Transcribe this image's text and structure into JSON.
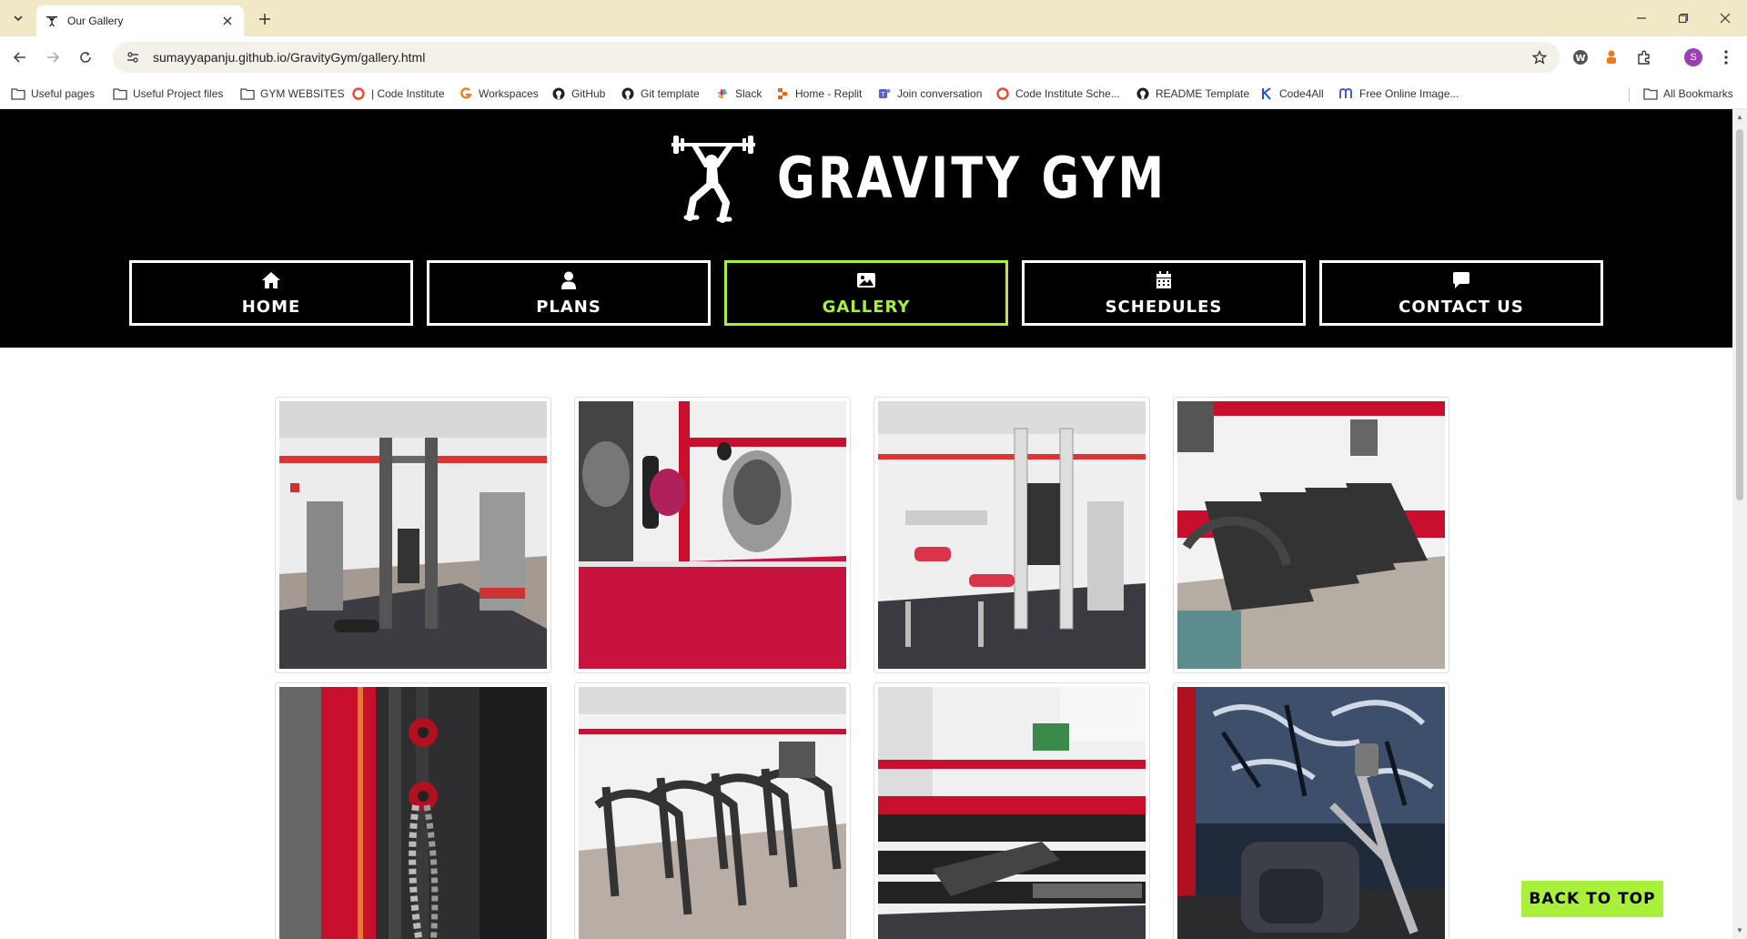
{
  "browser": {
    "tab_title": "Our Gallery",
    "url": "sumayyapanju.github.io/GravityGym/gallery.html",
    "profile_initial": "S",
    "bookmarks": [
      {
        "label": "Useful pages",
        "icon": "folder-icon"
      },
      {
        "label": "Useful Project files",
        "icon": "folder-icon"
      },
      {
        "label": "GYM WEBSITES",
        "icon": "folder-icon"
      },
      {
        "label": "| Code Institute",
        "icon": "code-institute-icon"
      },
      {
        "label": "Workspaces",
        "icon": "workspaces-icon"
      },
      {
        "label": "GitHub",
        "icon": "github-icon"
      },
      {
        "label": "Git template",
        "icon": "github-icon"
      },
      {
        "label": "Slack",
        "icon": "slack-icon"
      },
      {
        "label": "Home - Replit",
        "icon": "replit-icon"
      },
      {
        "label": "Join conversation",
        "icon": "teams-icon"
      },
      {
        "label": "Code Institute Sche...",
        "icon": "code-institute-icon"
      },
      {
        "label": "README Template",
        "icon": "github-icon"
      },
      {
        "label": "Code4All",
        "icon": "code4all-icon"
      },
      {
        "label": "Free Online Image...",
        "icon": "image-tool-icon"
      }
    ],
    "all_bookmarks_label": "All Bookmarks"
  },
  "site": {
    "logo_text": "GRAVITY GYM",
    "nav": [
      {
        "label": "HOME",
        "icon": "home-icon",
        "active": false
      },
      {
        "label": "PLANS",
        "icon": "user-icon",
        "active": false
      },
      {
        "label": "GALLERY",
        "icon": "image-icon",
        "active": true
      },
      {
        "label": "SCHEDULES",
        "icon": "calendar-icon",
        "active": false
      },
      {
        "label": "CONTACT US",
        "icon": "chat-icon",
        "active": false
      }
    ],
    "gallery": [
      {
        "subject": "gym-machines-floor"
      },
      {
        "subject": "boxing-area"
      },
      {
        "subject": "weight-machines"
      },
      {
        "subject": "treadmills"
      },
      {
        "subject": "rack-chains"
      },
      {
        "subject": "stair-climbers"
      },
      {
        "subject": "dumbbell-rack"
      },
      {
        "subject": "graffiti-elliptical"
      }
    ],
    "back_to_top": "BACK TO TOP"
  },
  "colors": {
    "accent": "#a8f03a",
    "header_bg": "#000000",
    "tabbar_bg": "#f1e8c5"
  }
}
